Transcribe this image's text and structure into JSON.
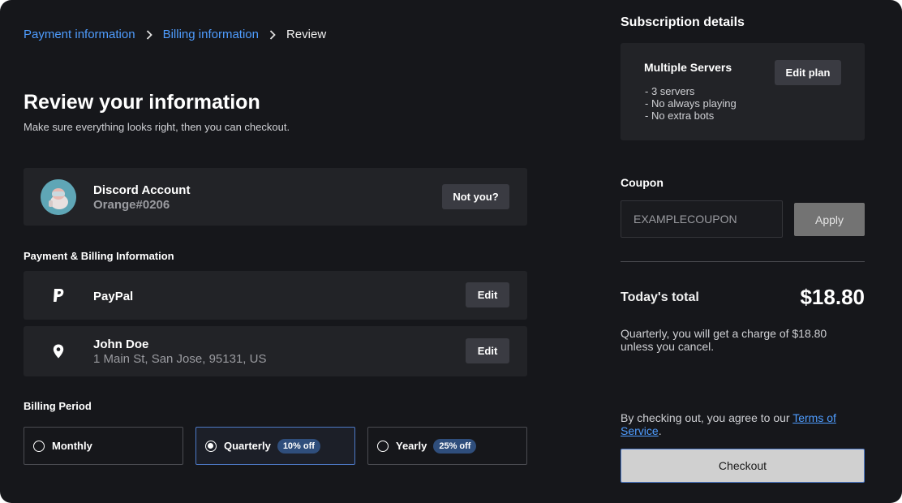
{
  "breadcrumb": {
    "items": [
      "Payment information",
      "Billing information"
    ],
    "current": "Review"
  },
  "header": {
    "title": "Review your information",
    "subtitle": "Make sure everything looks right, then you can checkout."
  },
  "account": {
    "title": "Discord Account",
    "username": "Orange#0206",
    "not_you_label": "Not you?"
  },
  "payment_section": {
    "label": "Payment & Billing Information",
    "method": "PayPal",
    "edit_label": "Edit"
  },
  "address": {
    "name": "John Doe",
    "line": "1 Main St, San Jose, 95131, US",
    "edit_label": "Edit"
  },
  "billing_period": {
    "label": "Billing Period",
    "options": [
      {
        "label": "Monthly",
        "badge": "",
        "selected": false
      },
      {
        "label": "Quarterly",
        "badge": "10% off",
        "selected": true
      },
      {
        "label": "Yearly",
        "badge": "25% off",
        "selected": false
      }
    ]
  },
  "subscription": {
    "title": "Subscription details",
    "plan_name": "Multiple Servers",
    "features": [
      "-  3 servers",
      "-  No always playing",
      "-  No extra bots"
    ],
    "edit_plan_label": "Edit plan"
  },
  "coupon": {
    "label": "Coupon",
    "placeholder": "EXAMPLECOUPON",
    "value": "",
    "apply_label": "Apply"
  },
  "totals": {
    "label": "Today's total",
    "amount": "$18.80",
    "note": "Quarterly, you will get a charge of $18.80 unless you cancel."
  },
  "terms": {
    "prefix": "By checking out, you agree to our ",
    "link": "Terms of Service",
    "suffix": "."
  },
  "checkout_label": "Checkout",
  "colors": {
    "background": "#16171b",
    "card": "#222327",
    "link": "#4f9dff",
    "selected_border": "#4d79c7",
    "badge": "#2f4e7c"
  }
}
